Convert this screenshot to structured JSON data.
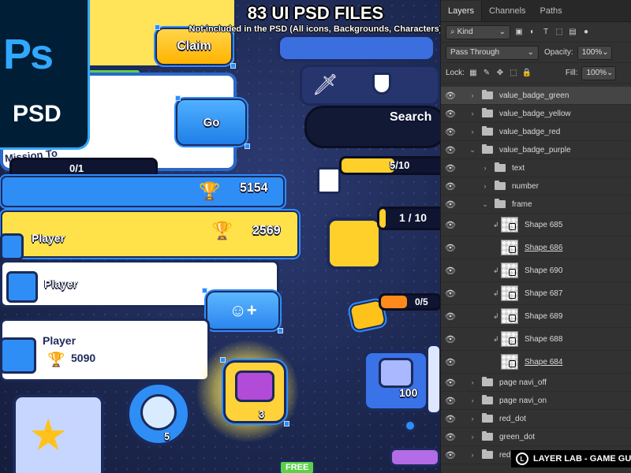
{
  "headline": {
    "title": "83 UI PSD FILES",
    "subtitle": "Not included in the PSD (All icons, Backgrounds, Characters)"
  },
  "ps_badge": {
    "logo": "Ps",
    "label": "PSD"
  },
  "game_ui": {
    "claim_label": "Claim",
    "go_label": "Go",
    "search_label": "Search",
    "mission_label": "Mission To",
    "mission_progress_text": "0/1",
    "mission_progress": 0,
    "task_progress_text": "5/10",
    "task_progress": 0.5,
    "chest_progress_text": "1 / 10",
    "chest_progress": 0.1,
    "crown_progress_text": "0/5",
    "crown_progress": 0.45,
    "leaderboard": [
      {
        "name": "",
        "score": "5154"
      },
      {
        "name": "Player",
        "score": "2569"
      },
      {
        "name": "Player",
        "score": ""
      },
      {
        "name": "Player",
        "score": "5090"
      }
    ],
    "diamond_count": "5",
    "chest_count": "3",
    "gem_count": "100",
    "free_label": "FREE",
    "colors": {
      "blue": "#2f8ef5",
      "yellow": "#ffe64d",
      "selection": "#2e8cff"
    },
    "icons": [
      "sword-icon",
      "shield-icon",
      "trophy-icon",
      "ghost-add-icon",
      "chest-icon",
      "star-icon",
      "diamond-icon",
      "crown-icon",
      "clipboard-check-icon"
    ]
  },
  "layers_panel": {
    "tabs": [
      "Layers",
      "Channels",
      "Paths"
    ],
    "active_tab": "Layers",
    "filter_kind": "Kind",
    "blend_mode": "Pass Through",
    "opacity_label": "Opacity:",
    "opacity_value": "100%",
    "lock_label": "Lock:",
    "fill_label": "Fill:",
    "fill_value": "100%",
    "layers": [
      {
        "name": "value_badge_green",
        "type": "group",
        "indent": 0,
        "expanded": false,
        "active": true
      },
      {
        "name": "value_badge_yellow",
        "type": "group",
        "indent": 0,
        "expanded": false
      },
      {
        "name": "value_badge_red",
        "type": "group",
        "indent": 0,
        "expanded": false
      },
      {
        "name": "value_badge_purple",
        "type": "group",
        "indent": 0,
        "expanded": true
      },
      {
        "name": "text",
        "type": "group",
        "indent": 1,
        "expanded": false
      },
      {
        "name": "number",
        "type": "group",
        "indent": 1,
        "expanded": false
      },
      {
        "name": "frame",
        "type": "group",
        "indent": 1,
        "expanded": true
      },
      {
        "name": "Shape 685",
        "type": "shape",
        "indent": 2,
        "clipped": true
      },
      {
        "name": "Shape 686",
        "type": "shape",
        "indent": 2,
        "clipped": false,
        "underline": true
      },
      {
        "name": "Shape 690",
        "type": "shape",
        "indent": 2,
        "clipped": true
      },
      {
        "name": "Shape 687",
        "type": "shape",
        "indent": 2,
        "clipped": true
      },
      {
        "name": "Shape 689",
        "type": "shape",
        "indent": 2,
        "clipped": true
      },
      {
        "name": "Shape 688",
        "type": "shape",
        "indent": 2,
        "clipped": true
      },
      {
        "name": "Shape 684",
        "type": "shape",
        "indent": 2,
        "clipped": false,
        "underline": true
      },
      {
        "name": "page navi_off",
        "type": "group",
        "indent": 0,
        "expanded": false
      },
      {
        "name": "page navi_on",
        "type": "group",
        "indent": 0,
        "expanded": false
      },
      {
        "name": "red_dot",
        "type": "group",
        "indent": 0,
        "expanded": false
      },
      {
        "name": "green_dot",
        "type": "group",
        "indent": 0,
        "expanded": false
      },
      {
        "name": "red_d",
        "type": "group",
        "indent": 0,
        "expanded": false
      }
    ]
  },
  "watermark": "LAYER LAB - GAME GUI"
}
